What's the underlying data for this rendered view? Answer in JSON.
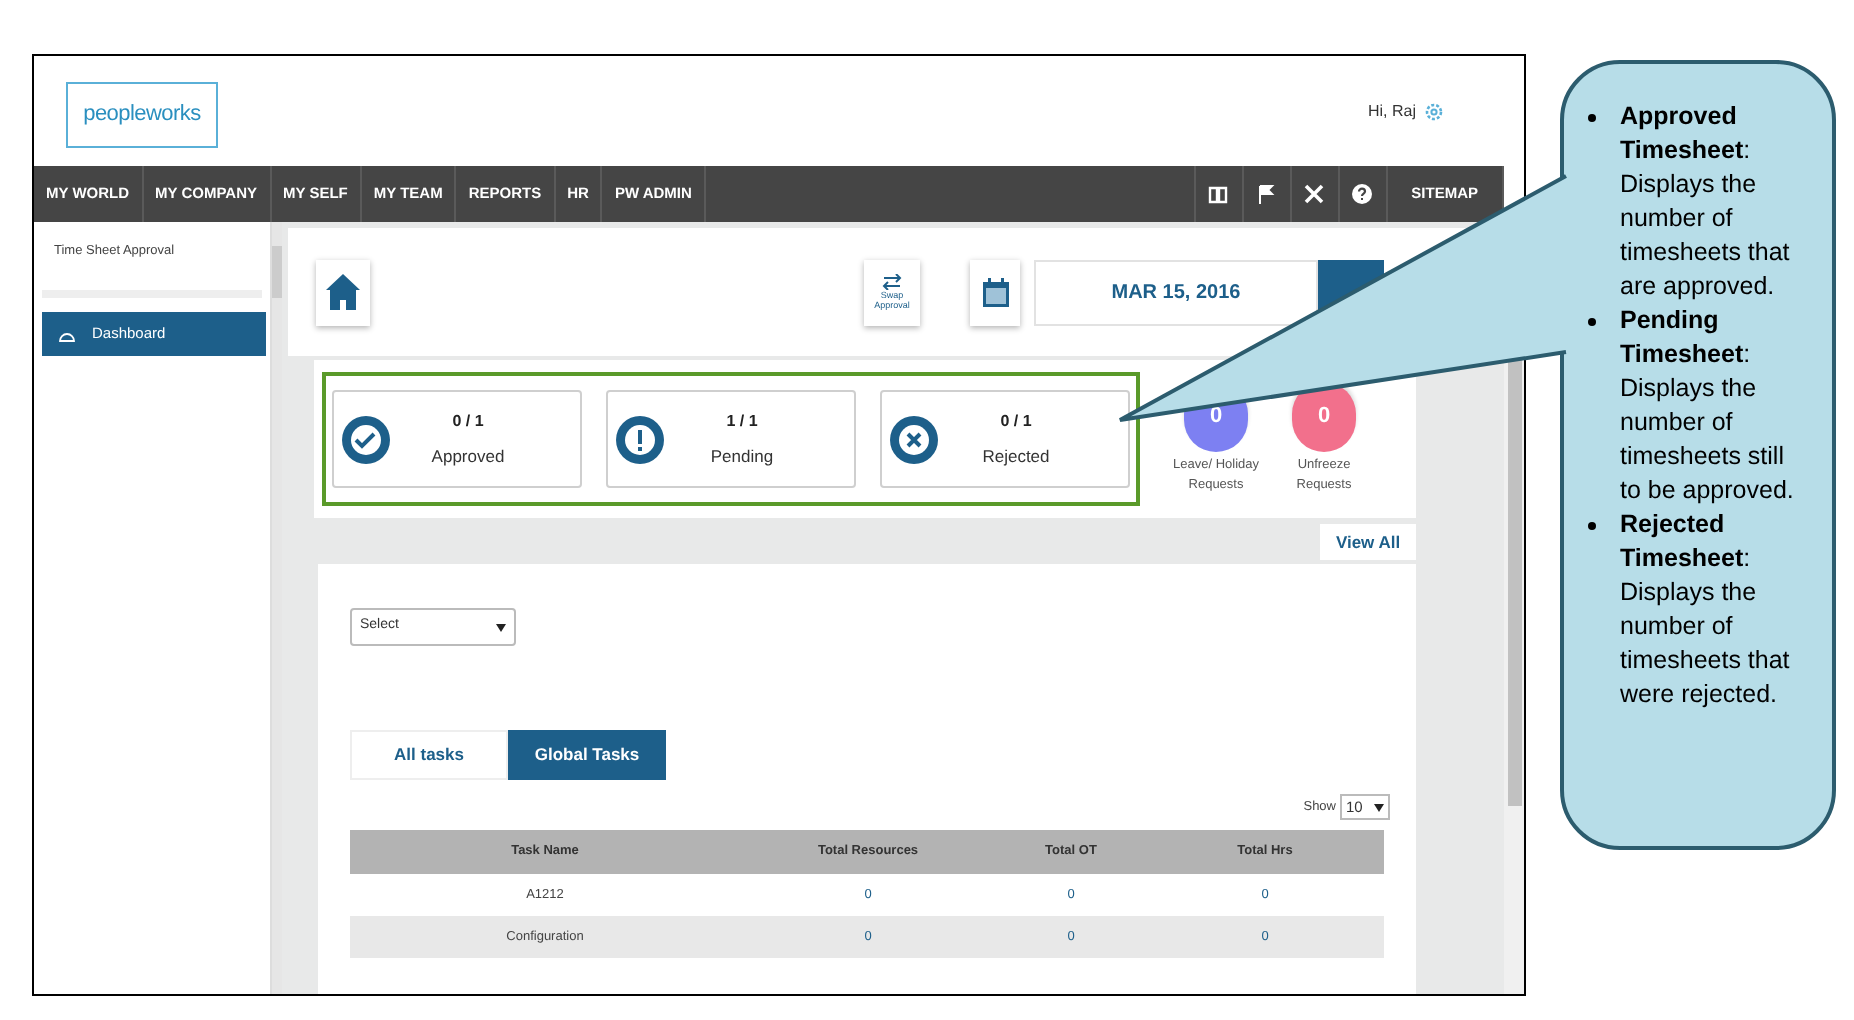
{
  "header": {
    "logo": "peopleworks",
    "greeting": "Hi, Raj"
  },
  "nav": {
    "items": [
      "MY WORLD",
      "MY COMPANY",
      "MY SELF",
      "MY TEAM",
      "REPORTS",
      "HR",
      "PW ADMIN"
    ],
    "sitemap": "SITEMAP"
  },
  "sidebar": {
    "title": "Time Sheet Approval",
    "items": [
      {
        "label": "Dashboard",
        "selected": true
      }
    ]
  },
  "toolbar": {
    "swap": "Swap Approval",
    "date": "MAR 15, 2016"
  },
  "summary": {
    "cards": [
      {
        "kind": "approved",
        "count": "0 / 1",
        "label": "Approved"
      },
      {
        "kind": "pending",
        "count": "1 / 1",
        "label": "Pending"
      },
      {
        "kind": "rejected",
        "count": "0 / 1",
        "label": "Rejected"
      }
    ],
    "requests": [
      {
        "count": "0",
        "label": "Leave/ Holiday Requests",
        "color": "#7d80f2"
      },
      {
        "count": "0",
        "label": "Unfreeze Requests",
        "color": "#f2708c"
      }
    ],
    "view_all": "View All"
  },
  "filter": {
    "value": "Select"
  },
  "tabs": [
    {
      "label": "All tasks",
      "selected": false
    },
    {
      "label": "Global Tasks",
      "selected": true
    }
  ],
  "show": {
    "label": "Show",
    "value": "10"
  },
  "table": {
    "columns": [
      "Task Name",
      "Total Resources",
      "Total OT",
      "Total Hrs"
    ],
    "rows": [
      [
        "A1212",
        "0",
        "0",
        "0"
      ],
      [
        "Configuration",
        "0",
        "0",
        "0"
      ]
    ]
  },
  "callout": {
    "items": [
      "**Approved Timesheet**: Displays the number of timesheets that are approved.",
      "**Pending Timesheet**: Displays the number of timesheets still to be approved.",
      "**Rejected Timesheet**: Displays the number of timesheets that were rejected."
    ]
  }
}
